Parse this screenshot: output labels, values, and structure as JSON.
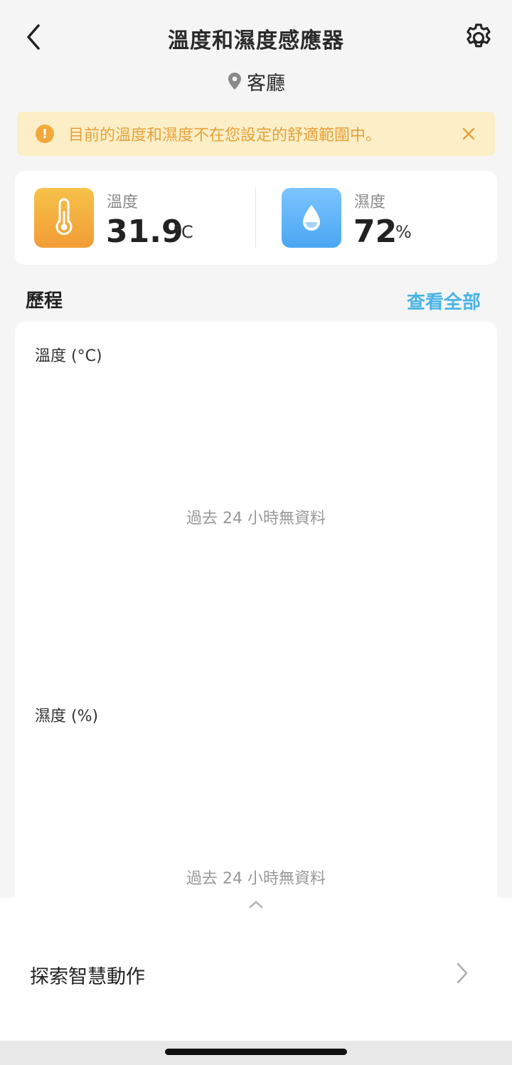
{
  "header": {
    "title": "溫度和濕度感應器",
    "back_icon": "chevron-left-icon",
    "settings_icon": "gear-icon"
  },
  "location": {
    "icon": "location-pin-icon",
    "name": "客廳"
  },
  "alert": {
    "icon": "warning-icon",
    "icon_glyph": "!",
    "message": "目前的溫度和濕度不在您設定的舒適範圍中。",
    "close_icon": "close-icon",
    "color": "#e6a03a"
  },
  "readings": {
    "temperature": {
      "label": "溫度",
      "value": "31.9",
      "unit": "°C",
      "icon": "thermometer-icon"
    },
    "humidity": {
      "label": "濕度",
      "value": "72",
      "unit": "%",
      "icon": "water-drop-icon"
    }
  },
  "history": {
    "title": "歷程",
    "view_all": "查看全部",
    "temperature_chart": {
      "label": "溫度 (°C)",
      "empty_message": "過去 24 小時無資料"
    },
    "humidity_chart": {
      "label": "濕度 (%)",
      "empty_message": "過去 24 小時無資料"
    }
  },
  "bottom_sheet": {
    "handle_icon": "chevron-up-icon",
    "explore_label": "探索智慧動作",
    "explore_chevron": "chevron-right-icon"
  },
  "colors": {
    "accent": "#4ab4e6",
    "alert_bg": "#fcefc7",
    "temp_tile": "#f2a93b",
    "humidity_tile": "#5ab0f5"
  }
}
